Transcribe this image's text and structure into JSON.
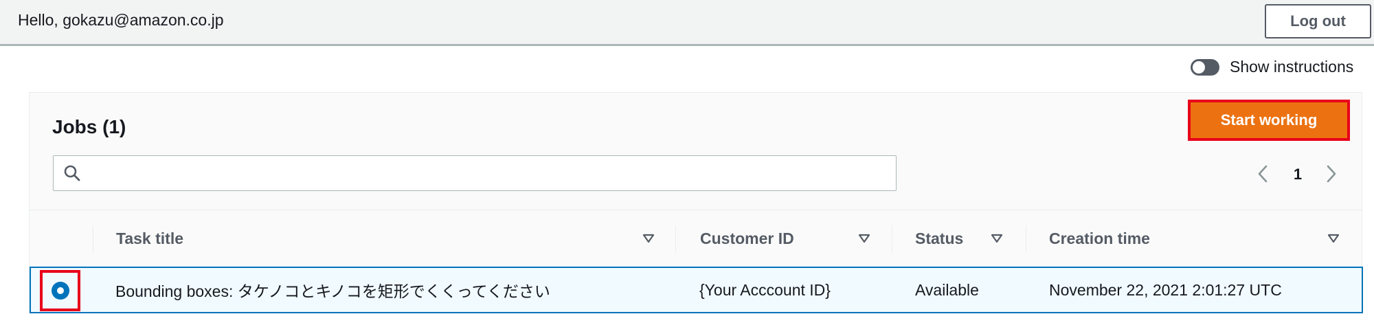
{
  "header": {
    "greeting": "Hello, gokazu@amazon.co.jp",
    "logout_label": "Log out"
  },
  "instructions_toggle": {
    "label": "Show instructions",
    "enabled": false
  },
  "jobs": {
    "title": "Jobs (1)",
    "start_label": "Start working",
    "search": {
      "value": "",
      "placeholder": ""
    },
    "pagination": {
      "current_page": "1"
    },
    "columns": [
      {
        "label": "Task title"
      },
      {
        "label": "Customer ID"
      },
      {
        "label": "Status"
      },
      {
        "label": "Creation time"
      }
    ],
    "rows": [
      {
        "selected": true,
        "task_title": "Bounding boxes: タケノコとキノコを矩形でくくってください",
        "customer_id": "{Your Acccount ID}",
        "status": "Available",
        "creation_time": "November 22, 2021 2:01:27 UTC"
      }
    ]
  },
  "colors": {
    "accent_orange": "#ec7211",
    "highlight_red": "#e8001a",
    "selection_blue": "#0073bb",
    "row_selected_bg": "#f1faff"
  },
  "icons": [
    "search-icon",
    "chevron-left-icon",
    "chevron-right-icon",
    "sort-down-icon",
    "radio-selected-icon"
  ]
}
